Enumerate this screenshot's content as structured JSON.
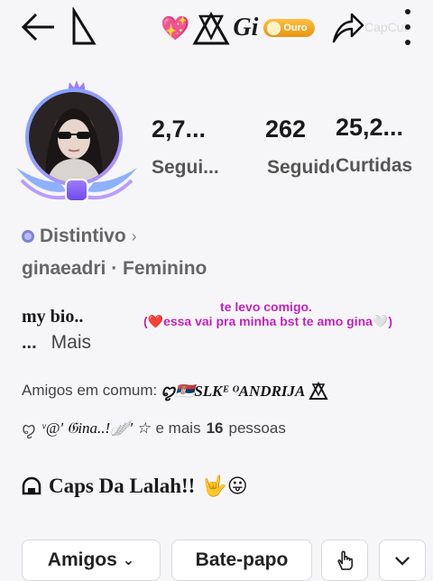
{
  "header": {
    "title_text": "Gi",
    "ouro_badge": "Ouro",
    "watermark": "CapCut",
    "heart_glyph": "💖"
  },
  "profile": {
    "stats": [
      {
        "value": "2,7...",
        "label": "Segui..."
      },
      {
        "value": "262",
        "label": "Seguidores"
      },
      {
        "value": "25,2...",
        "label": "Curtidas"
      }
    ],
    "badge_label": "Distintivo",
    "username_line": "ginaeadri · Feminino",
    "bio_line1": "my bio..",
    "bio_ellipsis": "...",
    "bio_more": "Mais"
  },
  "caption": {
    "line1": "te levo comigo.",
    "line2": "(❤️essa vai pra minha bst te amo gina🤍)"
  },
  "mutual": {
    "prefix": "Amigos em comum:",
    "names1": "ꨄ🇷🇸SLKᴱ ᴼANDRIJA",
    "names2": "ᵛ@' 𝔊ina..!🪽' ☆",
    "suffix_a": "e mais",
    "count": "16",
    "suffix_b": "pessoas"
  },
  "caps": {
    "text": "Caps Da Lalah!!",
    "emoji": "🤟😛"
  },
  "actions": {
    "friends": "Amigos",
    "chat": "Bate-papo"
  },
  "icons": {
    "back": "arrow-left-icon",
    "share": "share-icon",
    "more": "more-vertical-icon",
    "hand": "hand-pointer-icon",
    "dropdown": "chevron-down-icon"
  },
  "colors": {
    "caption": "#c61bc1",
    "ouro_badge": "#f0a020",
    "avatar_ring": "#8c9cff"
  }
}
